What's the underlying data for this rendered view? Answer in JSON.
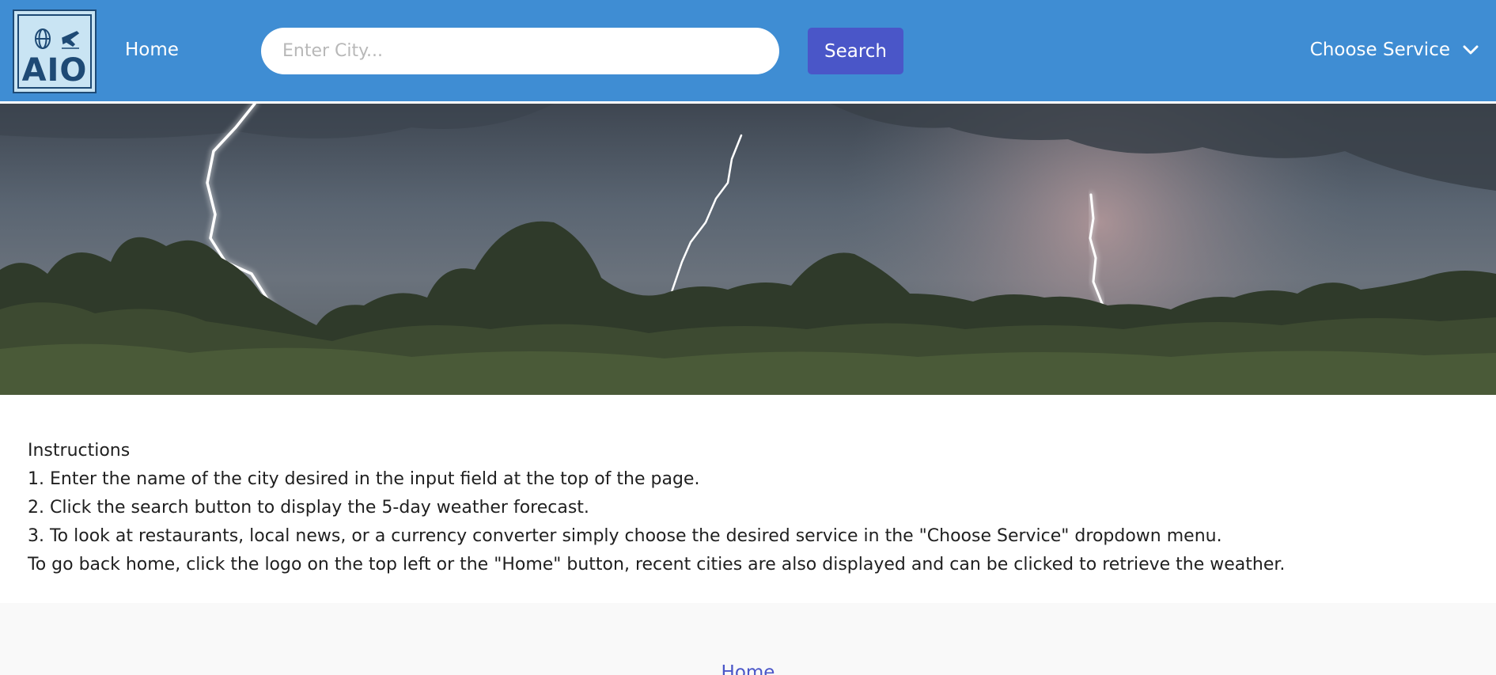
{
  "header": {
    "logo_text": "AIO",
    "home_label": "Home",
    "search": {
      "placeholder": "Enter City...",
      "value": ""
    },
    "search_button_label": "Search",
    "service_dropdown_label": "Choose Service"
  },
  "instructions": {
    "title": "Instructions",
    "steps": [
      "1. Enter the name of the city desired in the input field at the top of the page.",
      "2. Click the search button to display the 5-day weather forecast.",
      "3. To look at restaurants, local news, or a currency converter simply choose the desired service in the \"Choose Service\" dropdown menu.",
      "To go back home, click the logo on the top left or the \"Home\" button, recent cities are also displayed and can be clicked to retrieve the weather."
    ]
  },
  "footer": {
    "home_link": "Home"
  },
  "colors": {
    "navbar": "#3f8dd3",
    "search_button": "#4a56c8",
    "logo_bg": "#c9e4f3",
    "logo_ink": "#1e4a75",
    "footer_bg": "#f9f9f9"
  },
  "icons": {
    "logo_icons": [
      "globe-icon",
      "airplane-icon"
    ],
    "dropdown": "chevron-down-icon"
  }
}
